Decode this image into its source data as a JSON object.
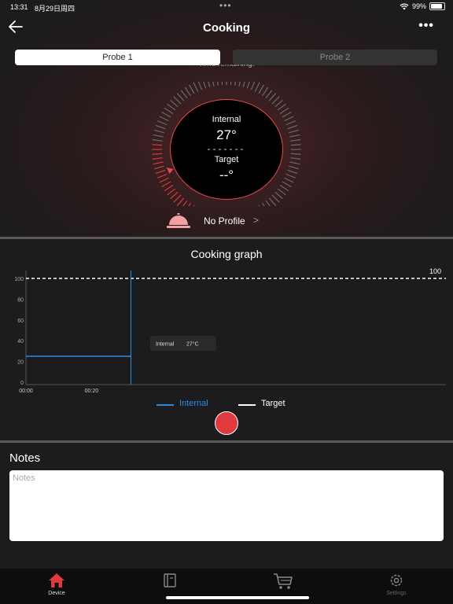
{
  "status_bar": {
    "time": "13:31",
    "date": "8月29日周四",
    "battery": "99%"
  },
  "nav": {
    "title": "Cooking"
  },
  "probe_tabs": [
    {
      "label": "Probe  1",
      "active": true
    },
    {
      "label": "Probe  2",
      "active": false
    }
  ],
  "time_remaining_partial": "Time remaining:",
  "gauge": {
    "internal_label": "Internal",
    "internal_value": "27°",
    "separator": "-------",
    "target_label": "Target",
    "target_value": "--°"
  },
  "profile": {
    "label": "No Profile",
    "chevron": ">"
  },
  "graph": {
    "title": "Cooking graph"
  },
  "chart_data": {
    "type": "line",
    "yticks": [
      "100",
      "80",
      "60",
      "40",
      "20",
      "0"
    ],
    "ylim": [
      0,
      100
    ],
    "xticks": [
      "00:00",
      "00:20"
    ],
    "target_line_label": "100",
    "series": [
      {
        "name": "Internal",
        "color": "#2f8cdc",
        "x": [
          "00:00",
          "00:32"
        ],
        "values": [
          25,
          25
        ]
      },
      {
        "name": "Target",
        "color": "#ffffff",
        "dashed": true,
        "values": [
          100,
          100
        ]
      }
    ],
    "tooltip": {
      "label": "Internal",
      "value": "27°C"
    },
    "legend": [
      "Internal",
      "Target"
    ]
  },
  "notes": {
    "title": "Notes",
    "placeholder": "Notes",
    "value": ""
  },
  "tab_bar": [
    {
      "label": "Device",
      "icon": "home-icon",
      "active": true
    },
    {
      "label": "",
      "icon": "book-icon",
      "active": false
    },
    {
      "label": "",
      "icon": "cart-icon",
      "active": false
    },
    {
      "label": "Settings",
      "icon": "gear-icon",
      "active": false
    }
  ],
  "colors": {
    "accent": "#e8474e",
    "internal_line": "#2f8cdc",
    "background": "#1c1c1e"
  }
}
